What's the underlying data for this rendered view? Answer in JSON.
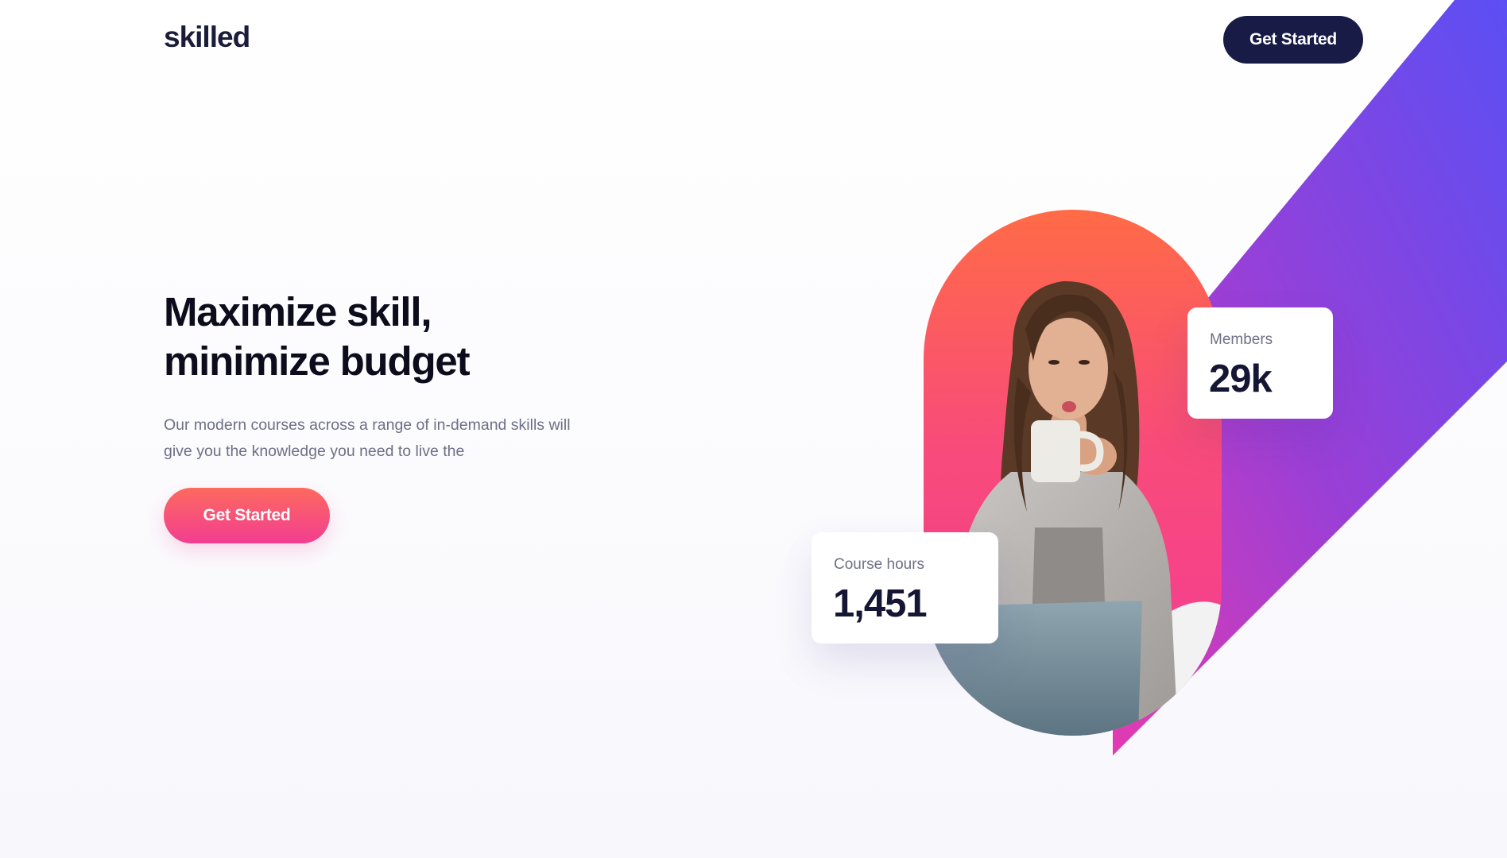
{
  "header": {
    "logo": "skilled",
    "cta_label": "Get Started"
  },
  "hero": {
    "title_line_1": "Maximize skill,",
    "title_line_2": "minimize budget",
    "description": "Our modern courses across a range of in-demand skills will give you the knowledge you need to live the",
    "cta_label": "Get Started"
  },
  "stats": {
    "members": {
      "label": "Members",
      "value": "29k"
    },
    "course_hours": {
      "label": "Course hours",
      "value": "1,451"
    }
  },
  "colors": {
    "brand_navy": "#181b45",
    "cta_gradient_start": "#fd6a5e",
    "cta_gradient_end": "#f23d91",
    "ribbon_purple": "#5b4ff4",
    "ribbon_pink": "#d43ab7",
    "pill_orange": "#ff6b46",
    "pill_pink": "#f43a97",
    "body_text": "#6d6f86",
    "heading_text": "#0c0c1c"
  }
}
